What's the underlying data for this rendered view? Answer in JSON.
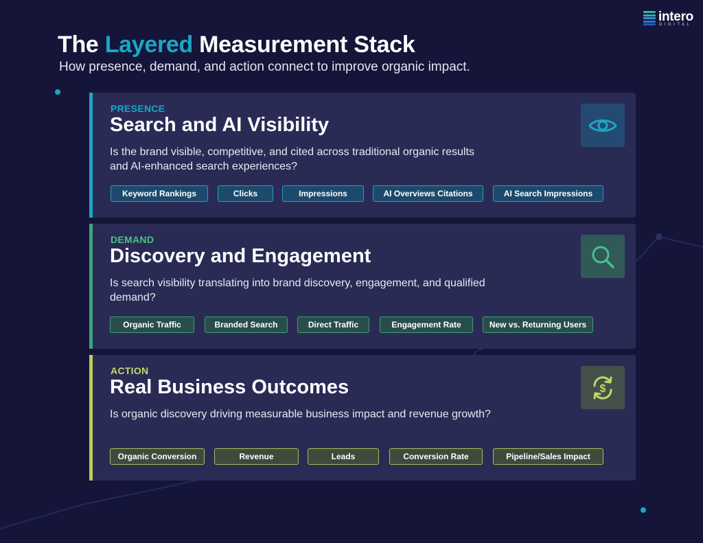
{
  "logo": {
    "name": "intero",
    "sub": "DIGITAL"
  },
  "title": {
    "prefix": "The ",
    "highlight": "Layered",
    "suffix": " Measurement Stack"
  },
  "subtitle": "How presence, demand, and action connect to improve organic impact.",
  "colors": {
    "background": "#15153a",
    "card": "#2a2b55",
    "presence_accent": "#1aa7c4",
    "demand_accent": "#4cc08b",
    "action_accent": "#c3d965"
  },
  "layers": [
    {
      "eyebrow": "PRESENCE",
      "heading": "Search and AI Visibility",
      "description": "Is the brand visible, competitive, and cited across traditional organic results and AI-enhanced search experiences?",
      "icon": "eye-icon",
      "metrics": [
        "Keyword Rankings",
        "Clicks",
        "Impressions",
        "AI Overviews Citations",
        "AI Search Impressions"
      ]
    },
    {
      "eyebrow": "DEMAND",
      "heading": "Discovery and Engagement",
      "description": "Is search visibility translating into brand discovery, engagement, and qualified demand?",
      "icon": "magnifier-icon",
      "metrics": [
        "Organic Traffic",
        "Branded Search",
        "Direct Traffic",
        "Engagement Rate",
        "New vs. Returning Users"
      ]
    },
    {
      "eyebrow": "ACTION",
      "heading": "Real Business Outcomes",
      "description": "Is organic discovery driving measurable business impact and revenue growth?",
      "icon": "dollar-cycle-icon",
      "metrics": [
        "Organic Conversion",
        "Revenue",
        "Leads",
        "Conversion Rate",
        "Pipeline/Sales Impact"
      ]
    }
  ]
}
